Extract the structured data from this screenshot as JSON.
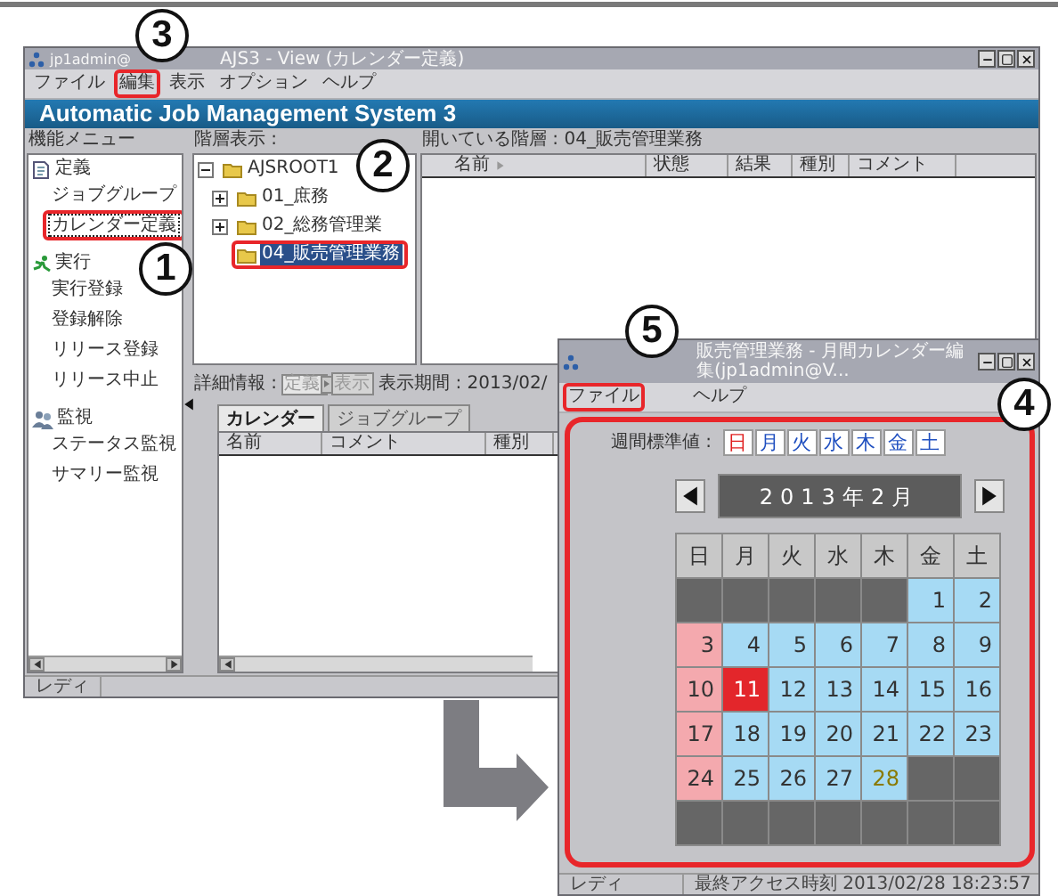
{
  "main_window": {
    "title_prefix": "jp1admin@",
    "title": "AJS3 - View (カレンダー定義)",
    "menu": [
      {
        "label": "ファイル",
        "marked": false
      },
      {
        "label": "編集",
        "marked": true
      },
      {
        "label": "表示",
        "marked": false
      },
      {
        "label": "オプション",
        "marked": false
      },
      {
        "label": "ヘルプ",
        "marked": false
      }
    ],
    "banner": "Automatic Job Management System 3",
    "function_menu": {
      "title": "機能メニュー",
      "groups": [
        {
          "kind": "define",
          "label": "定義",
          "items": [
            {
              "label": "ジョブグループ",
              "selected": false,
              "marked": false
            },
            {
              "label": "カレンダー定義",
              "selected": true,
              "marked": true
            }
          ]
        },
        {
          "kind": "run",
          "label": "実行",
          "items": [
            {
              "label": "実行登録",
              "selected": false,
              "marked": false
            },
            {
              "label": "登録解除",
              "selected": false,
              "marked": false
            },
            {
              "label": "リリース登録",
              "selected": false,
              "marked": false
            },
            {
              "label": "リリース中止",
              "selected": false,
              "marked": false
            }
          ]
        },
        {
          "kind": "monitor",
          "label": "監視",
          "items": [
            {
              "label": "ステータス監視",
              "selected": false,
              "marked": false
            },
            {
              "label": "サマリー監視",
              "selected": false,
              "marked": false
            }
          ]
        }
      ]
    },
    "tree": {
      "title": "階層表示 :",
      "items": [
        {
          "label": "AJSROOT1",
          "expanded": true,
          "selected": false,
          "marked": false,
          "children": [
            {
              "label": "01_庶務",
              "expanded": false,
              "selected": false,
              "marked": false
            },
            {
              "label": "02_総務管理業",
              "expanded": false,
              "selected": false,
              "marked": false
            },
            {
              "label": "04_販売管理業務",
              "selected": true,
              "marked": true
            }
          ]
        }
      ]
    },
    "list": {
      "title": "開いている階層 : 04_販売管理業務",
      "columns": [
        "名前",
        "状態",
        "結果",
        "種別",
        "コメント"
      ]
    },
    "details": {
      "label": "詳細情報 :",
      "dropdown": {
        "value": "定義",
        "disabled": true
      },
      "button": {
        "label": "表示",
        "disabled": true
      },
      "period": "表示期間 : 2013/02/",
      "tabs": [
        {
          "label": "カレンダー",
          "selected": true
        },
        {
          "label": "ジョブグループ",
          "selected": false
        }
      ],
      "columns": [
        "名前",
        "コメント",
        "種別"
      ]
    },
    "status_bar": "レディ"
  },
  "calendar_window": {
    "title": "販売管理業務 - 月間カレンダー編集(jp1admin@V...",
    "menu": [
      {
        "label": "ファイル",
        "marked": true
      },
      {
        "label": "ヘルプ",
        "marked": false
      }
    ],
    "body_marked": true,
    "weekly_label": "週間標準値 :",
    "weekly_defaults": [
      {
        "label": "日",
        "color": "#e02020"
      },
      {
        "label": "月",
        "color": "#2050c0"
      },
      {
        "label": "火",
        "color": "#2050c0"
      },
      {
        "label": "水",
        "color": "#2050c0"
      },
      {
        "label": "木",
        "color": "#2050c0"
      },
      {
        "label": "金",
        "color": "#2050c0"
      },
      {
        "label": "土",
        "color": "#2050c0"
      }
    ],
    "month": "2013年2月",
    "weekdays": [
      "日",
      "月",
      "火",
      "水",
      "木",
      "金",
      "土"
    ],
    "days": [
      {
        "kind": "blank"
      },
      {
        "kind": "blank"
      },
      {
        "kind": "blank"
      },
      {
        "kind": "blank"
      },
      {
        "kind": "blank"
      },
      {
        "kind": "open",
        "day": "1"
      },
      {
        "kind": "open",
        "day": "2"
      },
      {
        "kind": "closed",
        "day": "3"
      },
      {
        "kind": "open",
        "day": "4"
      },
      {
        "kind": "open",
        "day": "5"
      },
      {
        "kind": "open",
        "day": "6"
      },
      {
        "kind": "open",
        "day": "7"
      },
      {
        "kind": "open",
        "day": "8"
      },
      {
        "kind": "open",
        "day": "9"
      },
      {
        "kind": "closed",
        "day": "10"
      },
      {
        "kind": "highlight",
        "day": "11"
      },
      {
        "kind": "open",
        "day": "12"
      },
      {
        "kind": "open",
        "day": "13"
      },
      {
        "kind": "open",
        "day": "14"
      },
      {
        "kind": "open",
        "day": "15"
      },
      {
        "kind": "open",
        "day": "16"
      },
      {
        "kind": "closed",
        "day": "17"
      },
      {
        "kind": "open",
        "day": "18"
      },
      {
        "kind": "open",
        "day": "19"
      },
      {
        "kind": "open",
        "day": "20"
      },
      {
        "kind": "open",
        "day": "21"
      },
      {
        "kind": "open",
        "day": "22"
      },
      {
        "kind": "open",
        "day": "23"
      },
      {
        "kind": "closed",
        "day": "24"
      },
      {
        "kind": "open",
        "day": "25"
      },
      {
        "kind": "open",
        "day": "26"
      },
      {
        "kind": "open",
        "day": "27"
      },
      {
        "kind": "today",
        "day": "28"
      },
      {
        "kind": "blank"
      },
      {
        "kind": "blank"
      },
      {
        "kind": "blank"
      },
      {
        "kind": "blank"
      },
      {
        "kind": "blank"
      },
      {
        "kind": "blank"
      },
      {
        "kind": "blank"
      },
      {
        "kind": "blank"
      },
      {
        "kind": "blank"
      }
    ],
    "status_bar": [
      "レディ",
      "最終アクセス時刻 2013/02/28 18:23:57"
    ]
  },
  "callouts": [
    {
      "label": "3"
    },
    {
      "label": "1"
    },
    {
      "label": "2"
    },
    {
      "label": "5"
    },
    {
      "label": "4"
    }
  ]
}
